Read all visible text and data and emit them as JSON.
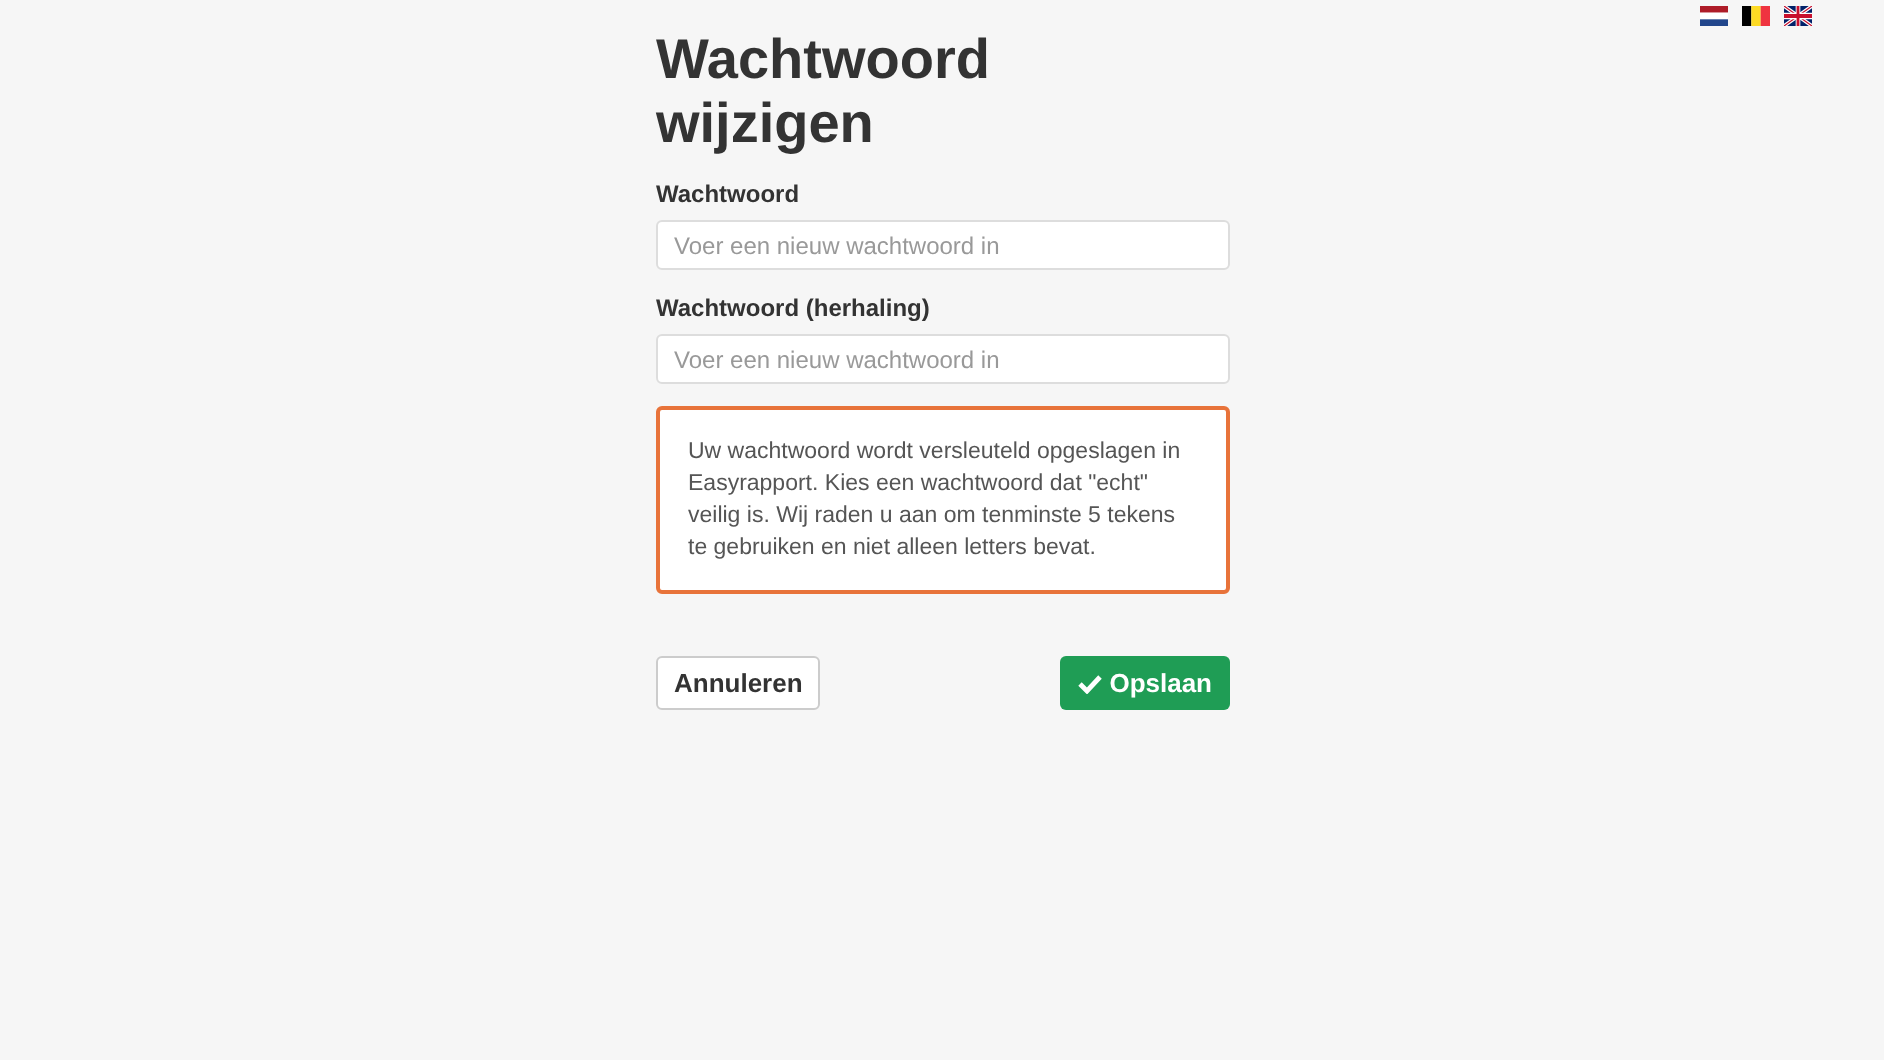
{
  "language_flags": [
    {
      "kind": "nl"
    },
    {
      "kind": "be"
    },
    {
      "kind": "gb"
    }
  ],
  "title": "Wachtwoord wijzigen",
  "fields": [
    {
      "label": "Wachtwoord",
      "placeholder": "Voer een nieuw wachtwoord in"
    },
    {
      "label": "Wachtwoord (herhaling)",
      "placeholder": "Voer een nieuw wachtwoord in"
    }
  ],
  "notice": "Uw wachtwoord wordt versleuteld opgeslagen in Easyrapport. Kies een wachtwoord dat \"echt\" veilig is. Wij raden u aan om tenminste 5 tekens te gebruiken en niet alleen letters bevat.",
  "buttons": [
    {
      "label": "Annuleren",
      "kind": "secondary"
    },
    {
      "label": "Opslaan",
      "kind": "primary"
    }
  ]
}
